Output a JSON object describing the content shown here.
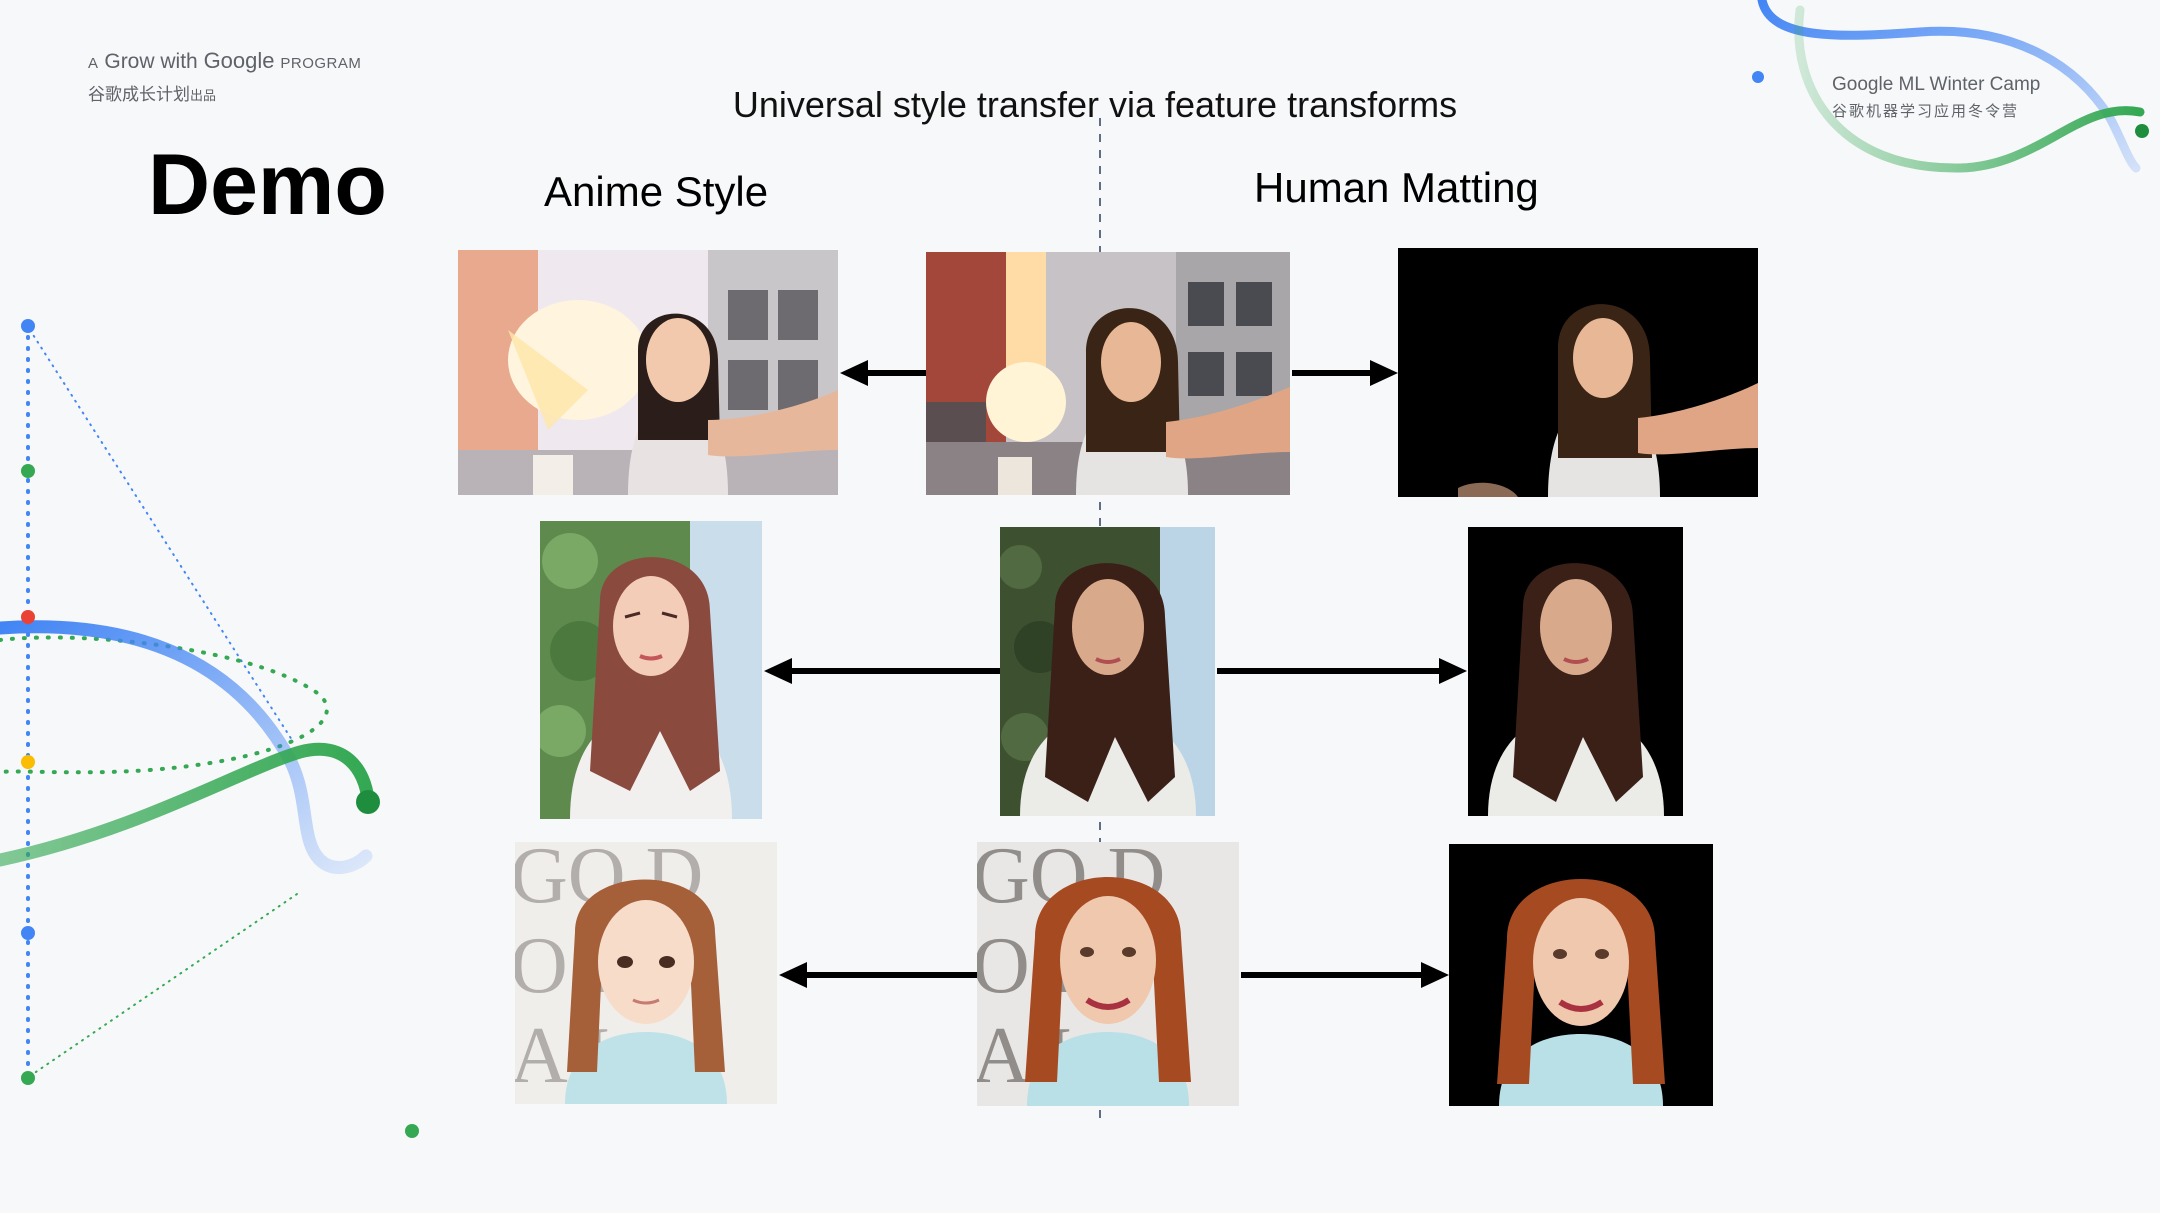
{
  "branding": {
    "left": {
      "prefix": "A",
      "name_a": "Grow with",
      "name_b": "Google",
      "suffix": "PROGRAM",
      "cn": "谷歌成长计划",
      "cn_suffix": "出品"
    },
    "right": {
      "title": "Google ML Winter Camp",
      "cn": "谷歌机器学习应用冬令营"
    }
  },
  "slide": {
    "subtitle": "Universal style transfer via feature transforms",
    "title": "Demo",
    "columns": {
      "anime": "Anime Style",
      "matting": "Human Matting"
    }
  },
  "rows": [
    {
      "name": "row-1-street-selfie"
    },
    {
      "name": "row-2-garden-selfie"
    },
    {
      "name": "row-3-redcarpet-portrait"
    }
  ],
  "colors": {
    "blue": "#4285f4",
    "green": "#34a853",
    "red": "#ea4335",
    "yellow": "#fbbc04",
    "background": "#f7f8fa"
  }
}
